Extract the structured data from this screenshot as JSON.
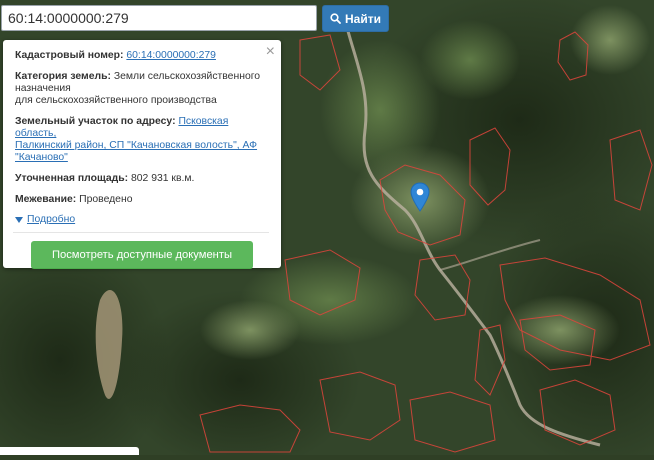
{
  "search": {
    "value": "60:14:0000000:279",
    "button_label": "Найти"
  },
  "popup": {
    "cadastral_label": "Кадастровый номер:",
    "cadastral_value": "60:14:0000000:279",
    "category_label": "Категория земель:",
    "category_value_1": "Земли сельскохозяйственного",
    "category_value_2": "назначения",
    "category_value_3": "для сельскохозяйственного производства",
    "address_label": "Земельный участок по адресу:",
    "address_value_1": "Псковская область,",
    "address_value_2": "Палкинский район, СП \"Качановская волость\", АФ",
    "address_value_3": "\"Качаново\"",
    "area_label": "Уточненная площадь:",
    "area_value": "802 931 кв.м.",
    "survey_label": "Межевание:",
    "survey_value": "Проведено",
    "more_label": "Подробно",
    "close_symbol": "×",
    "docs_button": "Посмотреть доступные документы"
  },
  "colors": {
    "accent_blue": "#337ab7",
    "link_blue": "#2a6fb5",
    "docs_green": "#5cb85c",
    "parcel_outline": "#e0453c",
    "marker": "#2f86d6"
  },
  "icons": {
    "search": "search-icon",
    "marker": "map-marker-icon",
    "close": "close-icon",
    "expand": "triangle-down-icon"
  }
}
